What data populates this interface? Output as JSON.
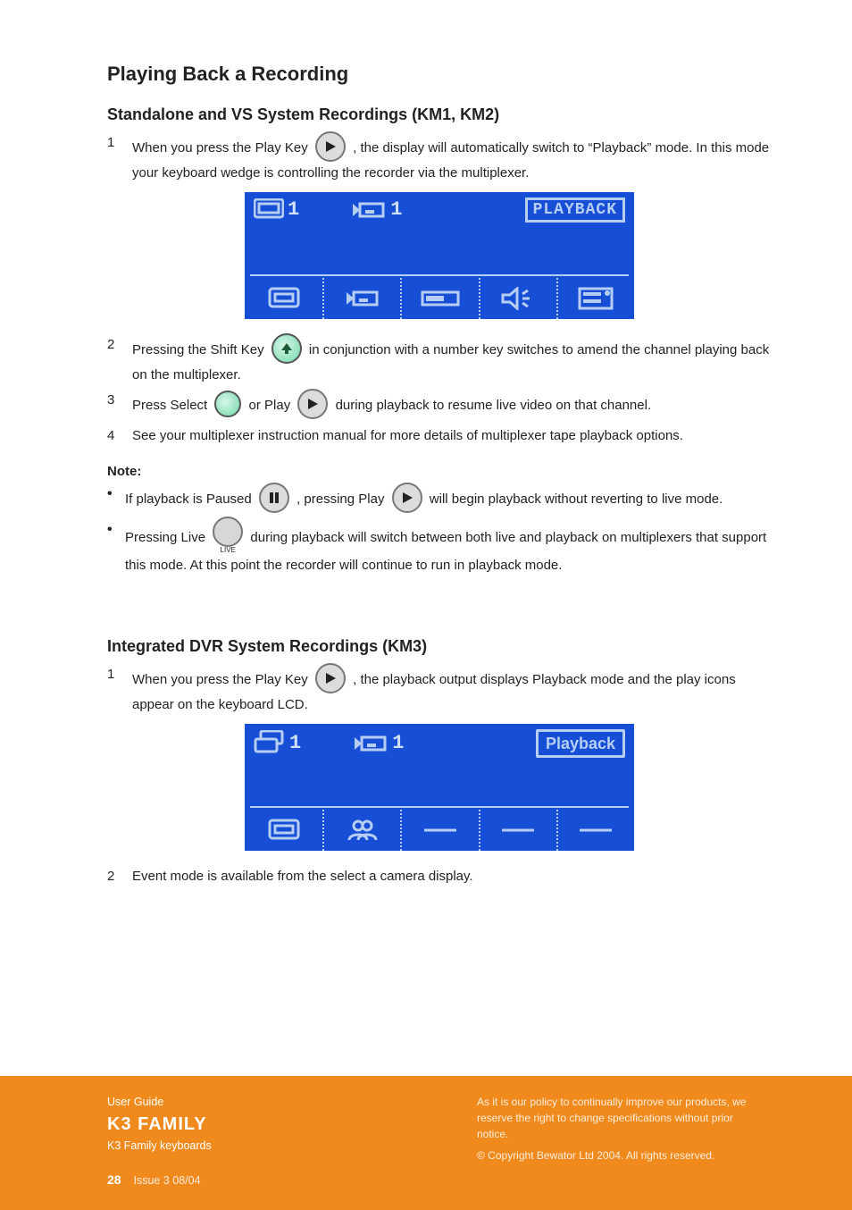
{
  "section": {
    "main_title": "Playing Back a Recording",
    "sub1_title": "Standalone and VS System Recordings (KM1, KM2)",
    "sub1": {
      "step1_num": "1",
      "step1_text": "When you press the Play Key        , the display will automatically switch to \"Playback\" mode. In this mode your keyboard wedge is controlling the recorder via the multiplexer.",
      "lcd1": {
        "status1_num": "1",
        "status2_num": "1",
        "badge": "PLAYBACK"
      },
      "step2_num": "2",
      "step2_text": "Pressing the Shift Key        in conjunction with a number key switches to amend the channel playing back on the multiplexer.",
      "step3_num": "3",
      "step3_text": " during playback to resume live video on that channel.",
      "step3_prefix": "Press Select        or Play",
      "step4_num": "4",
      "step4_text": "See your multiplexer instruction manual for more details of multiplexer tape playback options.",
      "note_label": "Note:",
      "note1_bullet": "•",
      "note1_text": "If playback is Paused        , pressing Play        will begin playback without reverting to live mode.",
      "note2_bullet": "•",
      "note2_text": "Pressing Live        during playback will switch between both live and playback on multiplexers that support this mode. At this point the recorder will continue to run in playback mode."
    },
    "sub2_title": "Integrated DVR System Recordings (KM3)",
    "sub2": {
      "step1_num": "1",
      "step1_text": "When you press the Play Key        , the playback output displays Playback mode and the play icons appear on the keyboard LCD.",
      "lcd2": {
        "status1_num": "1",
        "status2_num": "1",
        "badge": "Playback"
      },
      "step2_num": "2",
      "step2_text": "Event mode is available from the select a camera display."
    }
  },
  "footer": {
    "guide": "User Guide",
    "product": "K3 FAMILY",
    "model": "K3 Family keyboards",
    "page": "28",
    "rev": "Issue 3 08/04",
    "disclaimer1": "As it is our policy to continually improve our products, we reserve the right to change specifications without prior notice.",
    "disclaimer2": "© Copyright Bewator Ltd 2004. All rights reserved."
  }
}
